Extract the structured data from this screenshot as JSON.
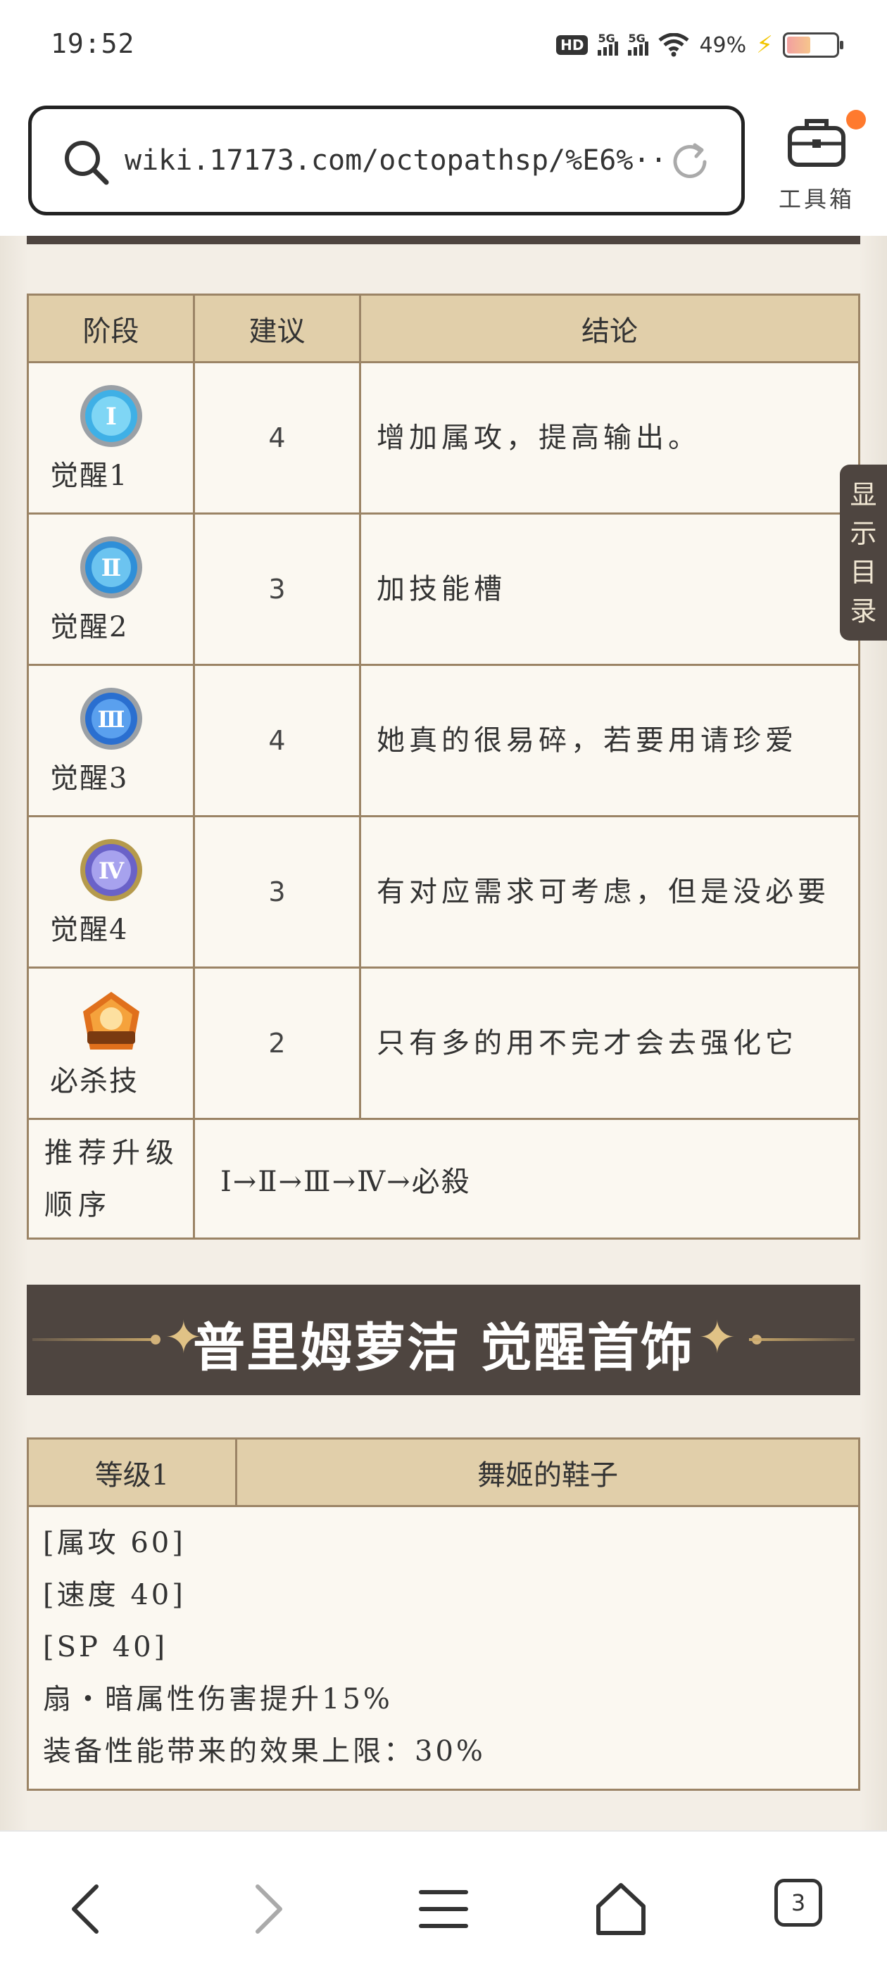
{
  "status_bar": {
    "time": "19:52",
    "hd_label": "HD",
    "net1": "5G",
    "net2": "5G",
    "battery_pct": "49%",
    "bolt": "⚡"
  },
  "browser": {
    "url": "wiki.17173.com/octopathsp/%E6%···",
    "toolbox_label": "工具箱",
    "tab_count": "3"
  },
  "skill_table": {
    "headers": [
      "阶段",
      "建议",
      "结论"
    ],
    "rows": [
      {
        "stage": "觉醒1",
        "icon": "awaken-1-icon",
        "suggestion": "4",
        "conclusion": "增加属攻，提高输出。"
      },
      {
        "stage": "觉醒2",
        "icon": "awaken-2-icon",
        "suggestion": "3",
        "conclusion": "加技能槽"
      },
      {
        "stage": "觉醒3",
        "icon": "awaken-3-icon",
        "suggestion": "4",
        "conclusion": "她真的很易碎，若要用请珍爱"
      },
      {
        "stage": "觉醒4",
        "icon": "awaken-4-icon",
        "suggestion": "3",
        "conclusion": "有对应需求可考虑，但是没必要"
      },
      {
        "stage": "必杀技",
        "icon": "ultimate-skill-icon",
        "suggestion": "2",
        "conclusion": "只有多的用不完才会去强化它"
      }
    ],
    "order_label": "推荐升级顺序",
    "order_value": "Ⅰ→Ⅱ→Ⅲ→Ⅳ→必殺"
  },
  "section": {
    "title": "普里姆萝洁 觉醒首饰"
  },
  "accessory_table": {
    "level": "等级1",
    "name": "舞姬的鞋子",
    "lines": [
      "[属攻 60]",
      "[速度 40]",
      "[SP 40]",
      "扇・暗属性伤害提升15%",
      "装备性能带来的效果上限：30%"
    ]
  },
  "toc": {
    "label": "显示目录"
  },
  "colors": {
    "header_bg": "#e1cfaa",
    "banner_bg": "#4e4540",
    "border": "#9b8466",
    "cell_bg": "#fbf8f1",
    "notif_dot": "#ff7a2e"
  }
}
